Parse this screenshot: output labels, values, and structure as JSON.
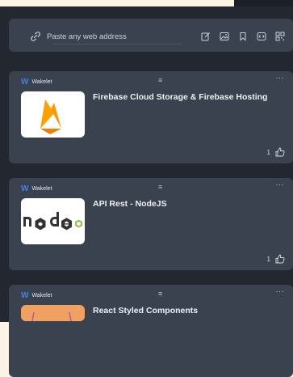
{
  "url_bar": {
    "placeholder": "Paste any web address",
    "tools": [
      "note-icon",
      "image-icon",
      "bookmark-icon",
      "embed-icon",
      "qr-icon"
    ]
  },
  "cards": [
    {
      "source": "Wakelet",
      "title": "Firebase Cloud Storage & Firebase Hosting",
      "likes": "1",
      "thumbnail_icon": "firebase-icon"
    },
    {
      "source": "Wakelet",
      "title": "API Rest - NodeJS",
      "likes": "1",
      "thumbnail_icon": "nodejs-logo"
    },
    {
      "source": "Wakelet",
      "title": "React Styled Components",
      "thumbnail_icon": "react-thumbnail"
    }
  ],
  "icons": {
    "handle": "≡",
    "more": "···"
  },
  "colors": {
    "background": "#232830",
    "card": "#3a424f",
    "brand": "#3d7ef0"
  }
}
